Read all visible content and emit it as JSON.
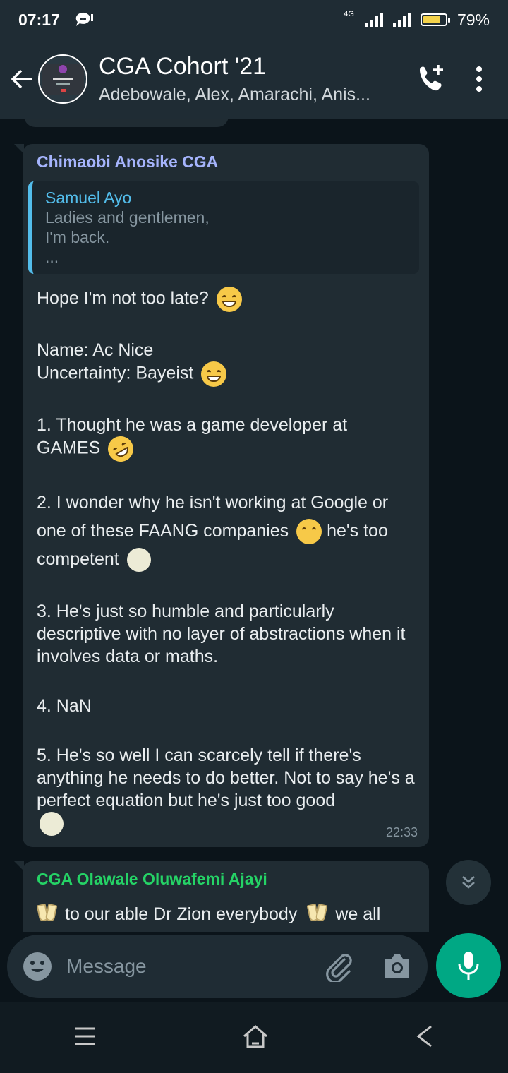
{
  "status_bar": {
    "time": "07:17",
    "network": "4G",
    "battery_level": 0.79,
    "battery_text": "79%"
  },
  "header": {
    "title": "CGA Cohort '21",
    "subtitle": "Adebowale, Alex, Amarachi, Anis..."
  },
  "messages": [
    {
      "sender": "Chimaobi Anosike CGA",
      "reply_to": {
        "name": "Samuel Ayo",
        "lines": [
          "Ladies and gentlemen,",
          "I'm back.",
          "..."
        ]
      },
      "paragraphs": [
        {
          "text": "Hope I'm not too late?",
          "emoji": "grinning-face"
        },
        {
          "lines": [
            "Name: Ac Nice",
            "Uncertainty: Bayeist"
          ],
          "emoji": "tears-of-joy"
        },
        {
          "text": "1. Thought he was a game developer at GAMES",
          "emoji": "rolling-on-floor-laughing"
        },
        {
          "text": "2. I wonder why he isn't working at Google or one of these FAANG companies",
          "emoji_mid": "thinking-face",
          "tail": "he's too competent",
          "emoji": "full-moon-face"
        },
        {
          "text": "3. He's just so humble and particularly descriptive with no layer of abstractions when it involves data or maths."
        },
        {
          "text": "4. NaN"
        },
        {
          "text": "5. He's so well I can scarcely tell if there's anything he needs to do better. Not to say he's a perfect equation but he's just too good",
          "emoji": "full-moon-face"
        }
      ],
      "time": "22:33"
    },
    {
      "sender": "CGA Olawale Oluwafemi Ajayi",
      "text_parts": [
        "to our able Dr Zion everybody",
        "we all"
      ]
    }
  ],
  "composer": {
    "placeholder": "Message"
  },
  "colors": {
    "background": "#0b141a",
    "bubble": "#202c33",
    "accent_green": "#00a884",
    "sender1": "#a5b4fc",
    "sender2": "#25d366",
    "quote_accent": "#53bdeb"
  }
}
